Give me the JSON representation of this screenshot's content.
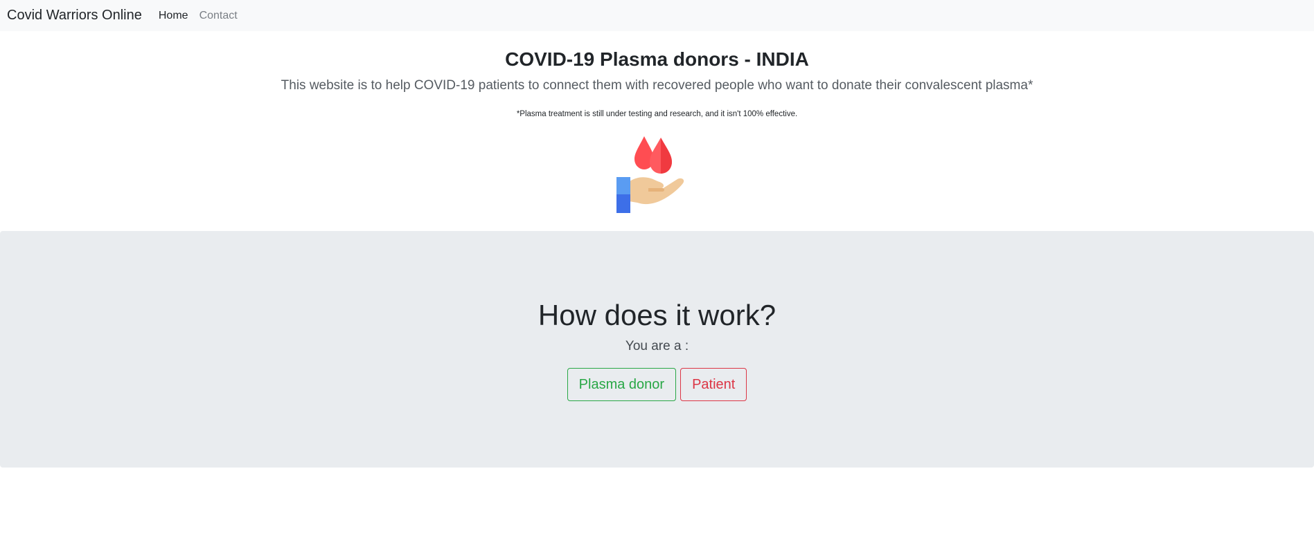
{
  "navbar": {
    "brand": "Covid Warriors Online",
    "links": [
      {
        "label": "Home"
      },
      {
        "label": "Contact"
      }
    ]
  },
  "hero": {
    "title": "COVID-19 Plasma donors - INDIA",
    "subtitle": "This website is to help COVID-19 patients to connect them with recovered people who want to donate their convalescent plasma*",
    "disclaimer": "*Plasma treatment is still under testing and research, and it isn't 100% effective.",
    "illustration_icon": "hand-holding-blood-drops-icon"
  },
  "how_it_works": {
    "title": "How does it work?",
    "prompt": "You are a :",
    "buttons": {
      "donor": "Plasma donor",
      "patient": "Patient"
    }
  },
  "colors": {
    "navbar_bg": "#f8f9fa",
    "jumbotron_bg": "#e9ecef",
    "success": "#28a745",
    "danger": "#dc3545",
    "drop_red": "#ff4d52",
    "drop_dark_red": "#f03a40",
    "skin": "#f0c99a",
    "sleeve_light_blue": "#5a9cf2",
    "sleeve_blue": "#3d6fe8"
  }
}
